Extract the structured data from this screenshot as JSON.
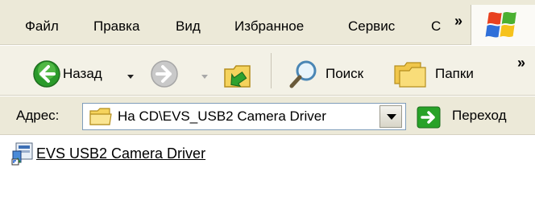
{
  "menu": {
    "items": [
      "Файл",
      "Правка",
      "Вид",
      "Избранное",
      "Сервис",
      "С"
    ],
    "overflow": "»"
  },
  "toolbar": {
    "back_label": "Назад",
    "search_label": "Поиск",
    "folders_label": "Папки",
    "overflow": "»"
  },
  "address": {
    "label": "Адрес:",
    "value": "На CD\\EVS_USB2 Camera Driver",
    "go_label": "Переход"
  },
  "content": {
    "items": [
      {
        "name": "EVS USB2 Camera Driver",
        "icon": "installer-shortcut-icon"
      }
    ]
  },
  "colors": {
    "menubar_bg": "#ece9d8",
    "toolbar_bg": "#f3f1e6",
    "back_green": "#2a9a2a",
    "go_green": "#28a228",
    "folder_yellow": "#f5d35c",
    "address_border": "#7f9db9"
  }
}
